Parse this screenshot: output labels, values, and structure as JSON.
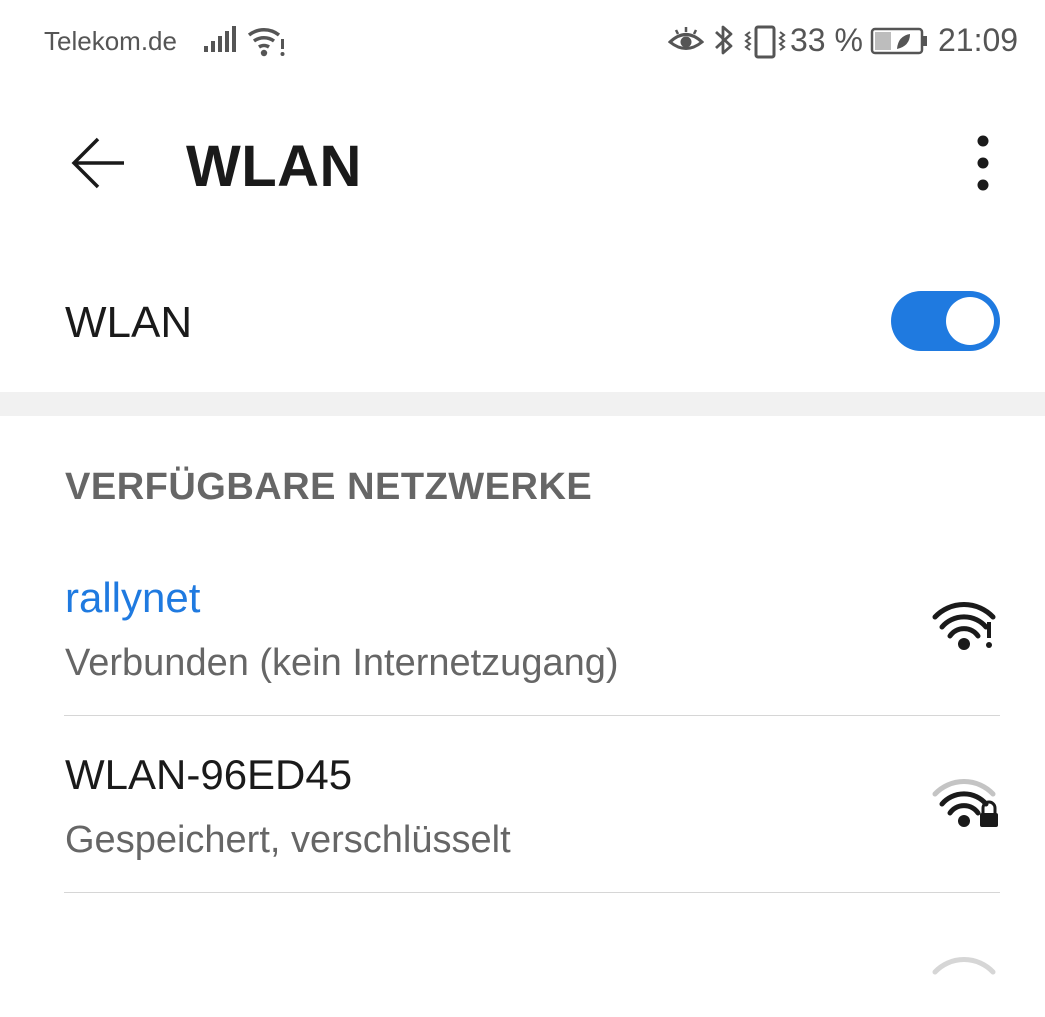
{
  "status_bar": {
    "carrier": "Telekom.de",
    "battery_percent": "33 %",
    "time": "21:09",
    "icons": [
      "signal-icon",
      "wifi-alert-icon",
      "eye-comfort-icon",
      "bluetooth-icon",
      "vibrate-icon",
      "battery-saver-icon"
    ]
  },
  "app_bar": {
    "title": "WLAN",
    "icons": [
      "back-arrow-icon",
      "more-vert-icon"
    ]
  },
  "wlan_toggle": {
    "label": "WLAN",
    "enabled": true,
    "accent_color": "#1f7ae0"
  },
  "available_networks": {
    "header": "VERFÜGBARE NETZWERKE",
    "networks": [
      {
        "name": "rallynet",
        "status": "Verbunden (kein Internetzugang)",
        "connected": true,
        "name_color": "#1f7ae0",
        "icon": "wifi-alert-icon"
      },
      {
        "name": "WLAN-96ED45",
        "status": "Gespeichert, verschlüsselt",
        "connected": false,
        "icon": "wifi-locked-icon"
      }
    ]
  }
}
